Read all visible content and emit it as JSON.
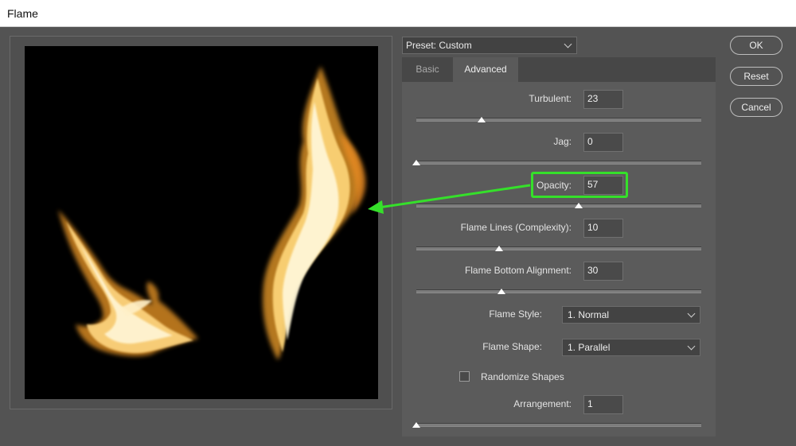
{
  "window": {
    "title": "Flame"
  },
  "preset": {
    "label": "Preset:",
    "value": "Custom"
  },
  "tabs": [
    {
      "label": "Basic"
    },
    {
      "label": "Advanced"
    }
  ],
  "fields": {
    "turbulent": {
      "label": "Turbulent:",
      "value": "23",
      "slider": 0.23
    },
    "jag": {
      "label": "Jag:",
      "value": "0",
      "slider": 0
    },
    "opacity": {
      "label": "Opacity:",
      "value": "57",
      "slider": 0.57
    },
    "flame_lines": {
      "label": "Flame Lines (Complexity):",
      "value": "10",
      "slider": 0.29
    },
    "flame_bottom": {
      "label": "Flame Bottom Alignment:",
      "value": "30",
      "slider": 0.3
    },
    "flame_style": {
      "label": "Flame Style:",
      "value": "1. Normal"
    },
    "flame_shape": {
      "label": "Flame Shape:",
      "value": "1. Parallel"
    },
    "randomize": {
      "label": "Randomize Shapes",
      "checked": false
    },
    "arrangement": {
      "label": "Arrangement:",
      "value": "1",
      "slider": 0
    }
  },
  "buttons": {
    "ok": "OK",
    "reset": "Reset",
    "cancel": "Cancel"
  },
  "colors": {
    "annotation": "#35e02a"
  }
}
